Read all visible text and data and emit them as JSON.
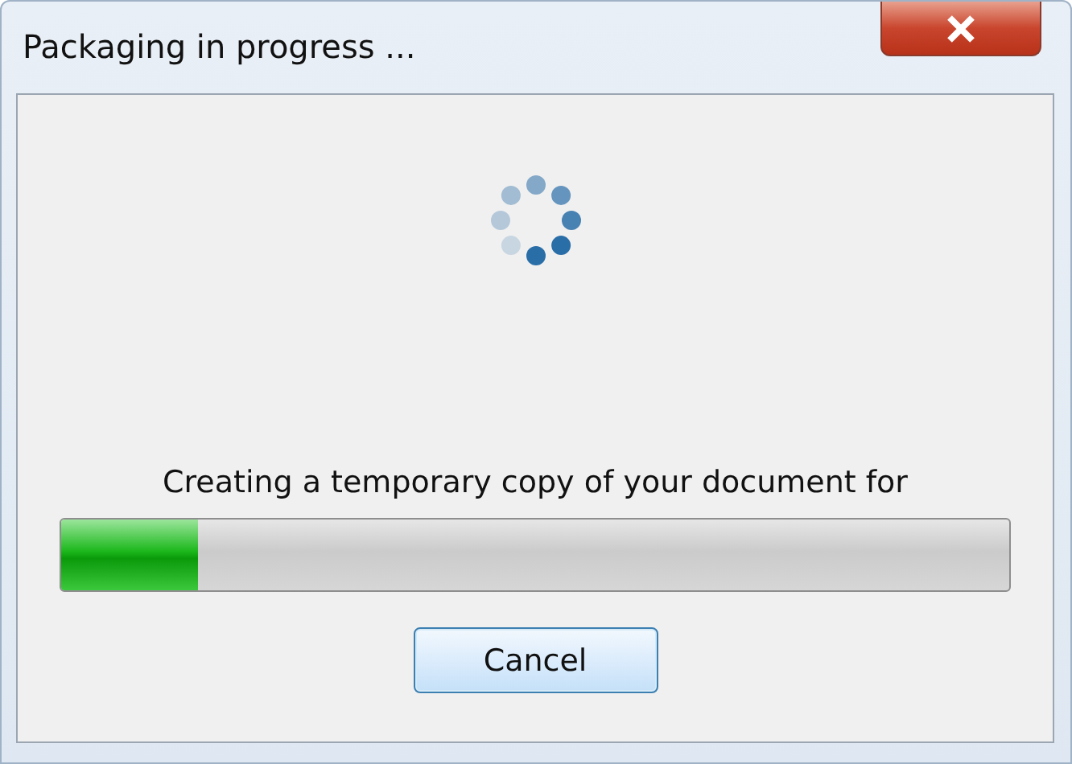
{
  "window": {
    "title": "Packaging in progress ..."
  },
  "message": "Creating a temporary copy of your document for",
  "progress": {
    "level": 0.145
  },
  "buttons": [
    {
      "label": "Cancel"
    }
  ]
}
